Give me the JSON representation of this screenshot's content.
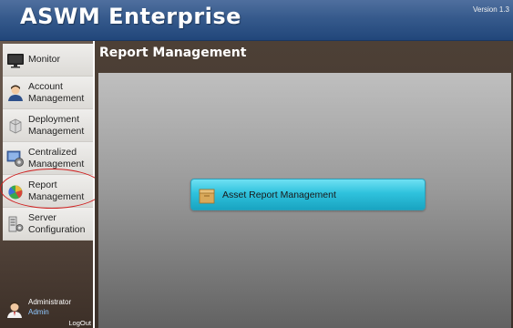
{
  "header": {
    "app_title": "ASWM Enterprise",
    "version": "Version 1.3"
  },
  "sidebar": {
    "items": [
      {
        "id": "monitor",
        "label": "Monitor",
        "icon": "monitor-icon"
      },
      {
        "id": "account",
        "label": "Account Management",
        "line1": "Account",
        "line2": "Management",
        "icon": "user-icon"
      },
      {
        "id": "deployment",
        "label": "Deployment Management",
        "line1": "Deployment",
        "line2": "Management",
        "icon": "deployment-icon"
      },
      {
        "id": "centralized",
        "label": "Centralized Management",
        "line1": "Centralized",
        "line2": "Management",
        "icon": "centralized-icon"
      },
      {
        "id": "report",
        "label": "Report Management",
        "line1": "Report",
        "line2": "Management",
        "icon": "report-chart-icon",
        "highlighted": true
      },
      {
        "id": "server",
        "label": "Server Configuration",
        "line1": "Server",
        "line2": "Configuration",
        "icon": "server-icon"
      }
    ]
  },
  "user": {
    "name": "Administrator",
    "role": "Admin",
    "logout_label": "LogOut"
  },
  "main": {
    "title": "Report Management",
    "actions": [
      {
        "label": "Asset Report Management",
        "icon": "box-icon"
      }
    ]
  },
  "colors": {
    "header_blue": "#2f5186",
    "accent_cyan": "#2fc2dd",
    "highlight_red": "#d02020",
    "sidebar_brown": "#5a4b41"
  }
}
